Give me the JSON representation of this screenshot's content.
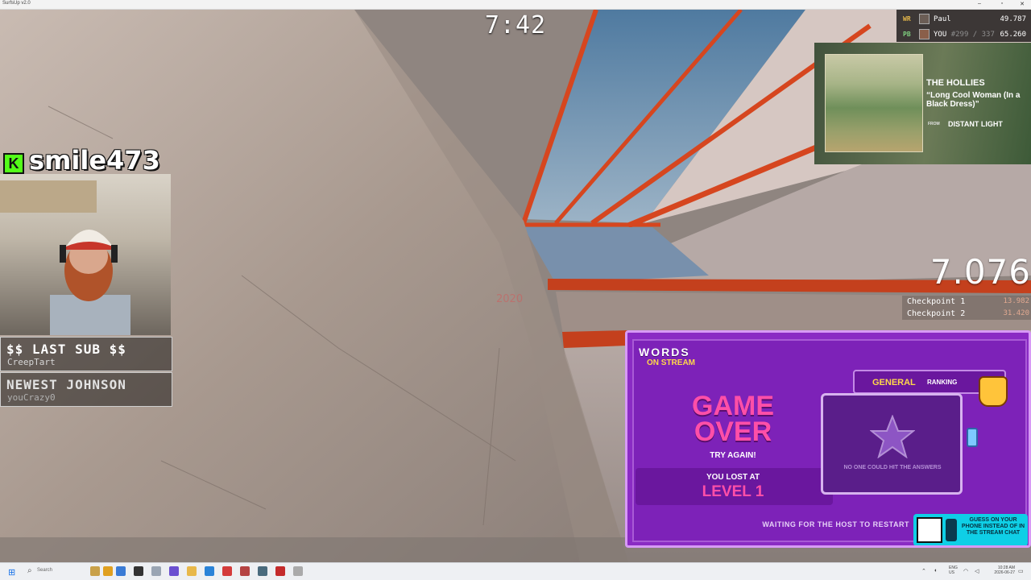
{
  "window": {
    "title": "SurfsUp v2.0"
  },
  "hud": {
    "timer": "7:42",
    "wall_label": "2020",
    "speed": "7.076",
    "checkpoints": [
      {
        "label": "Checkpoint 1",
        "time": "13.982"
      },
      {
        "label": "Checkpoint 2",
        "time": "31.420"
      }
    ]
  },
  "leaderboard": {
    "wr": {
      "tag": "WR",
      "name": "Paul",
      "rank": "",
      "time": "49.787"
    },
    "pb": {
      "tag": "PB",
      "name": "YOU",
      "rank": "#299 / 337",
      "time": "65.260"
    }
  },
  "now_playing": {
    "artist": "THE HOLLIES",
    "song": "“Long Cool Woman (In a Black Dress)”",
    "from_label": "FROM",
    "album": "DISTANT LIGHT"
  },
  "stream": {
    "streamer": "smile473",
    "badge_letter": "K",
    "last_sub": {
      "title": "$$ LAST SUB $$",
      "user": "CreepTart"
    },
    "newest": {
      "title": "NEWEST JOHNSON",
      "user": "youCrazy0"
    }
  },
  "words_on_stream": {
    "logo_top": "WORDS",
    "logo_bottom": "ON STREAM",
    "game_over": "GAME OVER",
    "try_again": "TRY AGAIN!",
    "lost_at": "YOU LOST AT",
    "level": "LEVEL 1",
    "ranking_general": "GENERAL",
    "ranking_label": "RANKING",
    "no_one": "NO ONE COULD HIT THE ANSWERS",
    "waiting": "WAITING FOR THE HOST TO RESTART",
    "guess_prompt": "GUESS ON YOUR PHONE INSTEAD OF IN THE STREAM CHAT"
  },
  "taskbar": {
    "search_placeholder": "Search",
    "lang": "ENG\nUS",
    "time": "10:28 AM",
    "date": "2026-06-27"
  },
  "colors": {
    "accent_red": "#d6461f",
    "wos_purple": "#8a2bc4",
    "wos_pink": "#ff4fa8",
    "kick_green": "#53fc18"
  }
}
